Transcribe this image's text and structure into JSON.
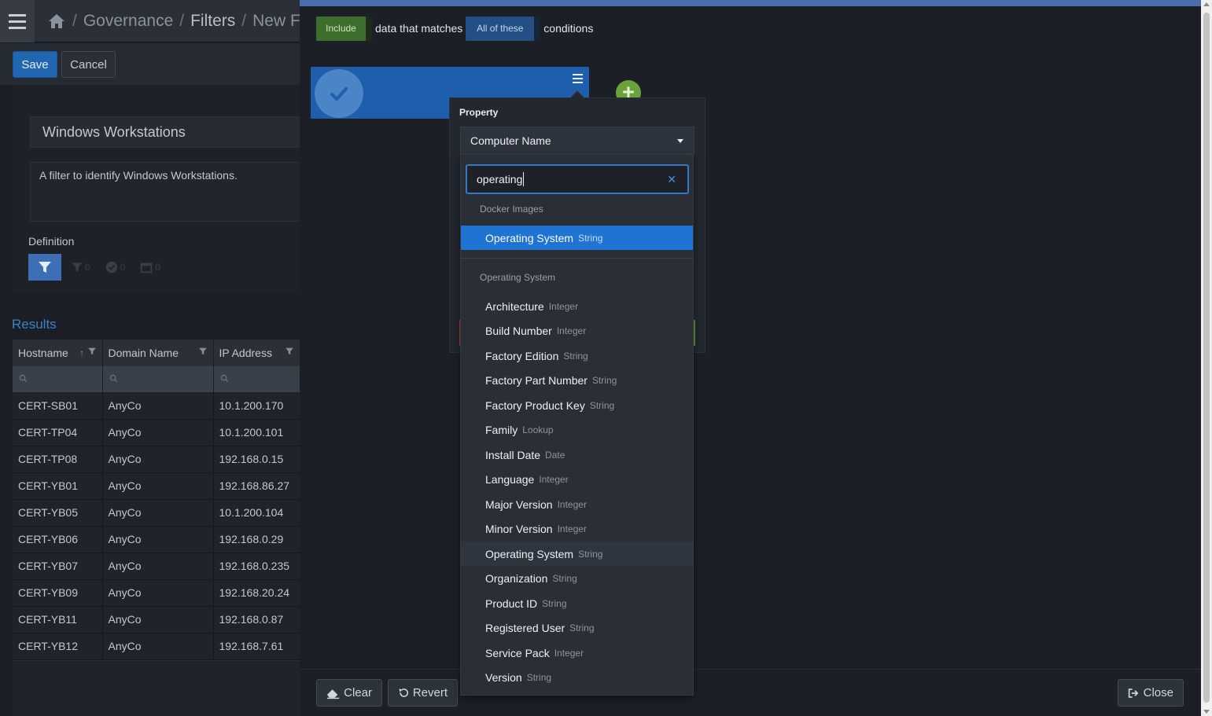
{
  "breadcrumb": {
    "items": [
      "Governance",
      "Filters",
      "New Fil"
    ],
    "separator": "/"
  },
  "toolbar": {
    "save_label": "Save",
    "cancel_label": "Cancel"
  },
  "filter": {
    "name": "Windows Workstations",
    "description": "A filter to identify Windows Workstations.",
    "definition_label": "Definition",
    "tabs": [
      {
        "name": "filter",
        "count": ""
      },
      {
        "name": "filter-sub",
        "count": "0"
      },
      {
        "name": "check",
        "count": "0"
      },
      {
        "name": "calendar",
        "count": "0"
      }
    ]
  },
  "results": {
    "label": "Results",
    "columns": [
      "Hostname",
      "Domain Name",
      "IP Address"
    ],
    "rows": [
      [
        "CERT-SB01",
        "AnyCo",
        "10.1.200.170"
      ],
      [
        "CERT-TP04",
        "AnyCo",
        "10.1.200.101"
      ],
      [
        "CERT-TP08",
        "AnyCo",
        "192.168.0.15"
      ],
      [
        "CERT-YB01",
        "AnyCo",
        "192.168.86.27"
      ],
      [
        "CERT-YB05",
        "AnyCo",
        "10.1.200.104"
      ],
      [
        "CERT-YB06",
        "AnyCo",
        "192.168.0.29"
      ],
      [
        "CERT-YB07",
        "AnyCo",
        "192.168.0.235"
      ],
      [
        "CERT-YB09",
        "AnyCo",
        "192.168.20.24"
      ],
      [
        "CERT-YB11",
        "AnyCo",
        "192.168.0.87"
      ],
      [
        "CERT-YB12",
        "AnyCo",
        "192.168.7.61"
      ]
    ]
  },
  "editor": {
    "include_label": "Include",
    "matches_text": "data that matches",
    "all_label": "All of these",
    "conditions_text": "conditions",
    "property_label": "Property",
    "property_value": "Computer Name",
    "search_value": "operating",
    "clear_label": "Clear",
    "revert_label": "Revert",
    "close_label": "Close"
  },
  "dropdown": {
    "groups": [
      {
        "header": "Docker Images",
        "options": [
          {
            "label": "Operating System",
            "type": "String",
            "selected": true
          }
        ]
      },
      {
        "header": "Operating System",
        "options": [
          {
            "label": "Architecture",
            "type": "Integer"
          },
          {
            "label": "Build Number",
            "type": "Integer"
          },
          {
            "label": "Factory Edition",
            "type": "String"
          },
          {
            "label": "Factory Part Number",
            "type": "String"
          },
          {
            "label": "Factory Product Key",
            "type": "String"
          },
          {
            "label": "Family",
            "type": "Lookup"
          },
          {
            "label": "Install Date",
            "type": "Date"
          },
          {
            "label": "Language",
            "type": "Integer"
          },
          {
            "label": "Major Version",
            "type": "Integer"
          },
          {
            "label": "Minor Version",
            "type": "Integer"
          },
          {
            "label": "Operating System",
            "type": "String",
            "hover": true
          },
          {
            "label": "Organization",
            "type": "String"
          },
          {
            "label": "Product ID",
            "type": "String"
          },
          {
            "label": "Registered User",
            "type": "String"
          },
          {
            "label": "Service Pack",
            "type": "Integer"
          },
          {
            "label": "Version",
            "type": "String"
          }
        ]
      }
    ]
  },
  "colors": {
    "accent_blue": "#1f73d3",
    "include_green": "#3e6e2b",
    "add_green": "#6aa23a",
    "link_blue": "#3b82c8"
  }
}
